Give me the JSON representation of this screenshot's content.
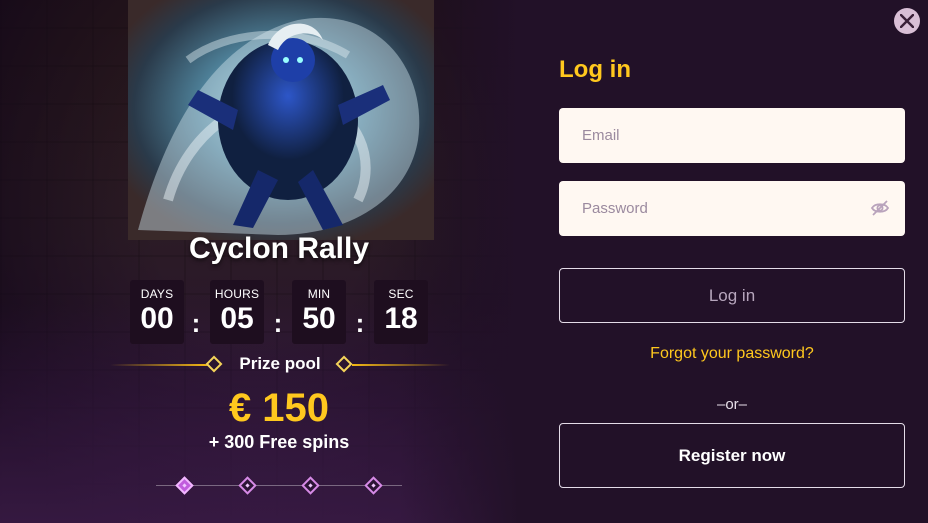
{
  "promo": {
    "event_title": "Cyclon Rally",
    "countdown": [
      {
        "label": "DAYS",
        "value": "00"
      },
      {
        "label": "HOURS",
        "value": "05"
      },
      {
        "label": "MIN",
        "value": "50"
      },
      {
        "label": "SEC",
        "value": "18"
      }
    ],
    "countdown_separator": ":",
    "prize_label": "Prize pool",
    "prize_amount": "€ 150",
    "prize_extra": "+ 300 Free spins",
    "pager": {
      "count": 4,
      "active_index": 0
    }
  },
  "login": {
    "title": "Log in",
    "email_placeholder": "Email",
    "password_placeholder": "Password",
    "login_button": "Log in",
    "forgot_link": "Forgot your password?",
    "or_text": "–or–",
    "register_button": "Register now"
  },
  "icons": {
    "close": "close-icon",
    "password_visibility": "eye-slash-icon"
  },
  "colors": {
    "accent": "#ffc81e",
    "background": "#221128",
    "field_bg": "#fff8f2"
  }
}
